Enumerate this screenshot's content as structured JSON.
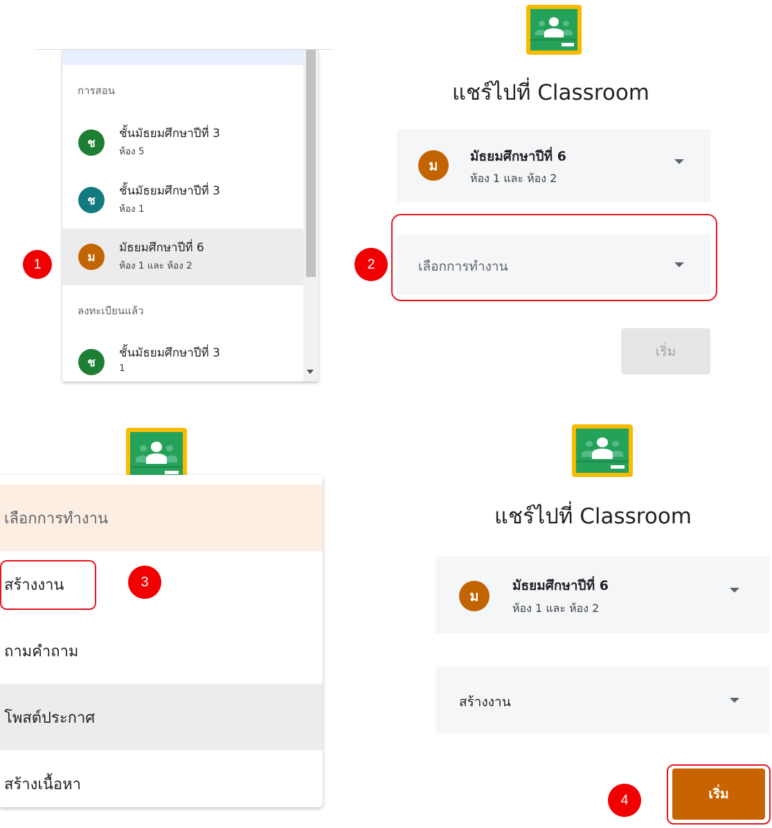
{
  "panel1": {
    "sections": [
      "การสอน",
      "ลงทะเบียนแล้ว"
    ],
    "classes": [
      {
        "initial": "ช",
        "name": "ชั้นมัธยมศึกษาปีที่ 3",
        "sub": "ห้อง 5",
        "color": "#1e7e34"
      },
      {
        "initial": "ช",
        "name": "ชั้นมัธยมศึกษาปีที่ 3",
        "sub": "ห้อง 1",
        "color": "#137a7f"
      },
      {
        "initial": "ม",
        "name": "มัธยมศึกษาปีที่ 6",
        "sub": "ห้อง 1 และ ห้อง 2",
        "color": "#c26401",
        "selected": true
      },
      {
        "initial": "ช",
        "name": "ชั้นมัธยมศึกษาปีที่ 3",
        "sub": "1",
        "color": "#1e7e34"
      }
    ]
  },
  "share": {
    "title": "แชร์ไปที่ Classroom",
    "class_initial": "ม",
    "class_name": "มัธยมศึกษาปีที่ 6",
    "class_sub": "ห้อง 1 และ ห้อง 2",
    "action_placeholder": "เลือกการทำงาน",
    "action_selected": "สร้างงาน",
    "start_label": "เริ่ม"
  },
  "menu": {
    "header": "เลือกการทำงาน",
    "items": [
      "สร้างงาน",
      "ถามคำถาม",
      "โพสต์ประกาศ",
      "สร้างเนื้อหา"
    ]
  },
  "steps": [
    "1",
    "2",
    "3",
    "4"
  ],
  "colors": {
    "accent": "#c86400",
    "badge": "#f00000",
    "ring": "#e8141c",
    "logo_board": "#25a25a",
    "logo_frame": "#f9bb00"
  }
}
